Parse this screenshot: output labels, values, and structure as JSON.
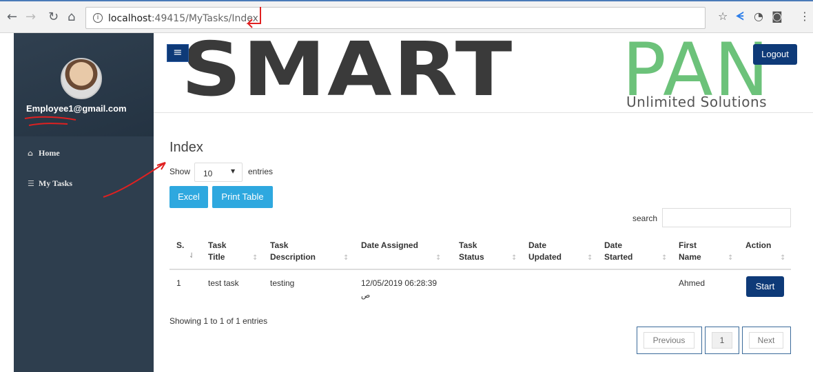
{
  "browser": {
    "url_info_icon": "info-icon",
    "url_host": "localhost",
    "url_rest": ":49415/MyTasks/Index",
    "nav_icons": [
      "back-icon",
      "forward-icon",
      "reload-icon",
      "home-icon"
    ],
    "ext_icons": [
      "star-icon",
      "extension-icon",
      "speed-icon",
      "camera-icon",
      "menu-icon"
    ]
  },
  "sidebar": {
    "email": "Employee1@gmail.com",
    "items": [
      {
        "icon": "home-icon",
        "label": "Home"
      },
      {
        "icon": "list-icon",
        "label": "My Tasks"
      }
    ],
    "bg_color": "#2e3e4e"
  },
  "header": {
    "logo_primary": "SMART",
    "logo_secondary": "PAN",
    "logo_tagline": "Unlimited Solutions",
    "logout_label": "Logout",
    "brand_color": "#0e3a78",
    "logo_green": "#6cc27a"
  },
  "main": {
    "title": "Index",
    "show_label": "Show",
    "page_length": "10",
    "entries_label": "entries",
    "excel_label": "Excel",
    "print_label": "Print Table",
    "search_label": "search",
    "button_color": "#2ea8df"
  },
  "table": {
    "columns": [
      [
        "S.",
        ""
      ],
      [
        "Task",
        "Title"
      ],
      [
        "Task",
        "Description"
      ],
      [
        "Date Assigned",
        ""
      ],
      [
        "Task",
        "Status"
      ],
      [
        "Date",
        "Updated"
      ],
      [
        "Date",
        "Started"
      ],
      [
        "First",
        "Name"
      ],
      [
        "Action",
        ""
      ]
    ],
    "rows": [
      {
        "serial": "1",
        "title": "test task",
        "description": "testing",
        "date_assigned": "12/05/2019 06:28:39",
        "date_assigned_suffix": "ص",
        "status": "",
        "updated": "",
        "started": "",
        "first_name": "Ahmed",
        "action": "Start"
      }
    ],
    "info": "Showing 1 to 1 of 1 entries",
    "pager": {
      "previous": "Previous",
      "current": "1",
      "next": "Next"
    }
  }
}
